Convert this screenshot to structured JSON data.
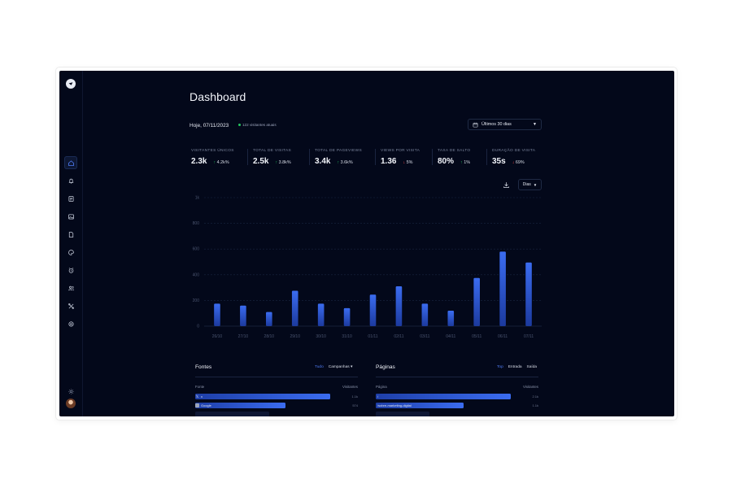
{
  "page": {
    "title": "Dashboard",
    "date": "Hoje, 07/11/2023",
    "live_visitors": "122 visitantes atuais",
    "range_label": "Últimos 30 dias",
    "granularity": "Dias"
  },
  "stats": [
    {
      "label": "VISITANTES ÚNICOS",
      "value": "2.3k",
      "change": "4.2k%",
      "direction": "up"
    },
    {
      "label": "TOTAL DE VISITAS",
      "value": "2.5k",
      "change": "3.8k%",
      "direction": "up"
    },
    {
      "label": "TOTAL DE PAGEVIEWS",
      "value": "3.4k",
      "change": "3.6k%",
      "direction": "up"
    },
    {
      "label": "VIEWS POR VISITA",
      "value": "1.36",
      "change": "5%",
      "direction": "down"
    },
    {
      "label": "TAXA DE SALTO",
      "value": "80%",
      "change": "1%",
      "direction": "up"
    },
    {
      "label": "DURAÇÃO DE VISITA",
      "value": "35s",
      "change": "69%",
      "direction": "down"
    }
  ],
  "chart_data": {
    "type": "bar",
    "categories": [
      "26/10",
      "27/10",
      "28/10",
      "29/10",
      "30/10",
      "31/10",
      "01/11",
      "02/11",
      "03/11",
      "04/11",
      "05/11",
      "06/11",
      "07/11"
    ],
    "values": [
      175,
      160,
      110,
      275,
      175,
      140,
      245,
      310,
      175,
      120,
      375,
      580,
      495
    ],
    "yticks": [
      "0",
      "200",
      "400",
      "600",
      "800",
      "1k"
    ],
    "ylim": [
      0,
      1000
    ],
    "grid": true,
    "colors": {
      "bar_top": "#3b6cf0",
      "bar_bottom": "#1c3a9e"
    }
  },
  "fontes": {
    "title": "Fontes",
    "tabs": [
      "Tudo",
      "Campanhas ▾"
    ],
    "col_left": "Fonte",
    "col_right": "Visitantes",
    "rows": [
      {
        "icon": "x-logo-icon",
        "label": "x",
        "value": "1.1k",
        "share": 1.0
      },
      {
        "icon": "google-icon",
        "label": "Google",
        "value": "574",
        "share": 0.67
      },
      {
        "icon": "source-icon",
        "label": "",
        "value": "",
        "share": 0.55
      }
    ]
  },
  "paginas": {
    "title": "Páginas",
    "tabs": [
      "Top",
      "Entrada",
      "Saída"
    ],
    "col_left": "Página",
    "col_right": "Visitantes",
    "rows": [
      {
        "label": "/",
        "value": "2.1k",
        "share": 1.0
      },
      {
        "label": "/sobre-marketing-digital",
        "value": "1.1k",
        "share": 0.65
      },
      {
        "label": "",
        "value": "",
        "share": 0.4
      }
    ]
  },
  "sidebar": {
    "items": [
      "home-icon",
      "bell-icon",
      "document-icon",
      "image-icon",
      "file-icon",
      "palette-icon",
      "alarm-icon",
      "users-icon",
      "tools-icon",
      "settings-icon"
    ],
    "active": "home-icon",
    "bottom": [
      "sun-icon",
      "avatar"
    ]
  },
  "colors": {
    "background": "#03081a",
    "accent": "#3b6cf0",
    "up": "#22c55e",
    "down": "#ef4444"
  }
}
